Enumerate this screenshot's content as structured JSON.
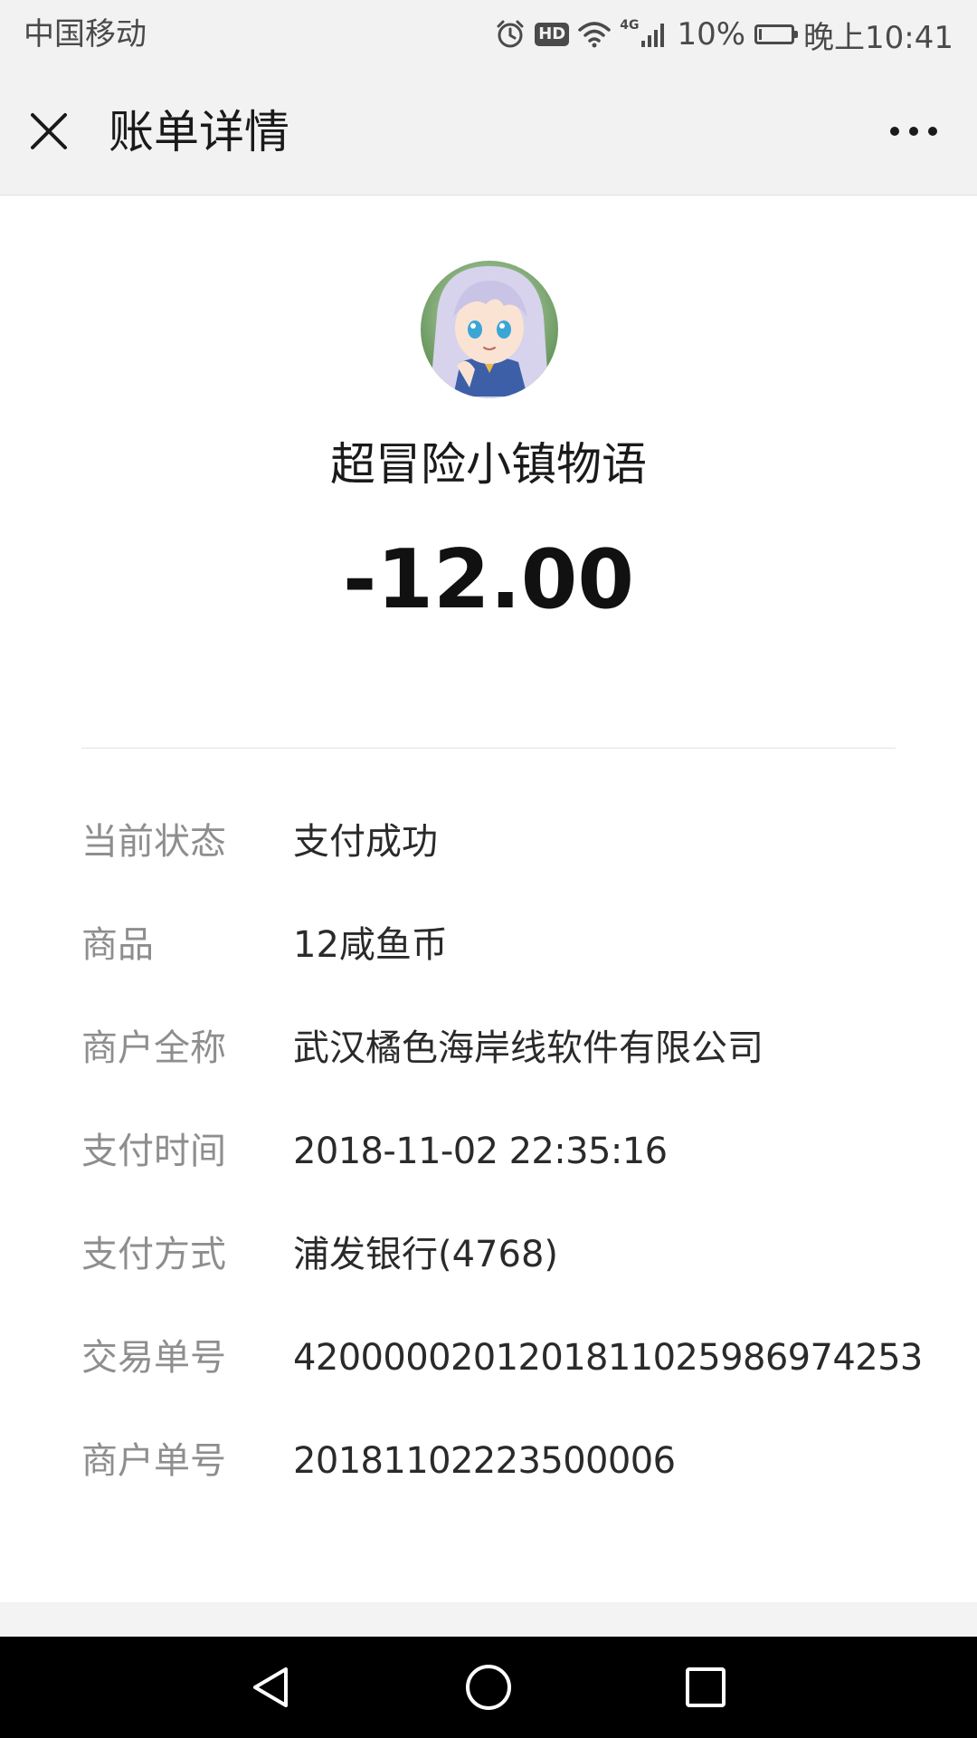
{
  "status_bar": {
    "carrier": "中国移动",
    "network": "4G",
    "battery": "10%",
    "battery_level": 0.1,
    "time": "晚上10:41",
    "icons": [
      "alarm-icon",
      "hd-icon",
      "wifi-icon",
      "signal-icon",
      "battery-icon"
    ]
  },
  "header": {
    "title": "账单详情",
    "close_icon": "close-icon",
    "more_icon": "more-icon"
  },
  "summary": {
    "merchant": "超冒险小镇物语",
    "amount": "-12.00"
  },
  "details": [
    {
      "label": "当前状态",
      "value": "支付成功"
    },
    {
      "label": "商品",
      "value": "12咸鱼币"
    },
    {
      "label": "商户全称",
      "value": "武汉橘色海岸线软件有限公司"
    },
    {
      "label": "支付时间",
      "value": "2018-11-02 22:35:16"
    },
    {
      "label": "支付方式",
      "value": "浦发银行(4768)"
    },
    {
      "label": "交易单号",
      "value": "4200000201201811025986974253"
    },
    {
      "label": "商户单号",
      "value": "20181102223500006"
    }
  ],
  "nav": {
    "back_icon": "back-triangle-icon",
    "home_icon": "home-circle-icon",
    "recents_icon": "recents-square-icon"
  },
  "colors": {
    "header_bg": "#f2f2f2",
    "label_gray": "#8e8e8e",
    "text_dark": "#1a1a1a",
    "nav_bg": "#000000"
  }
}
